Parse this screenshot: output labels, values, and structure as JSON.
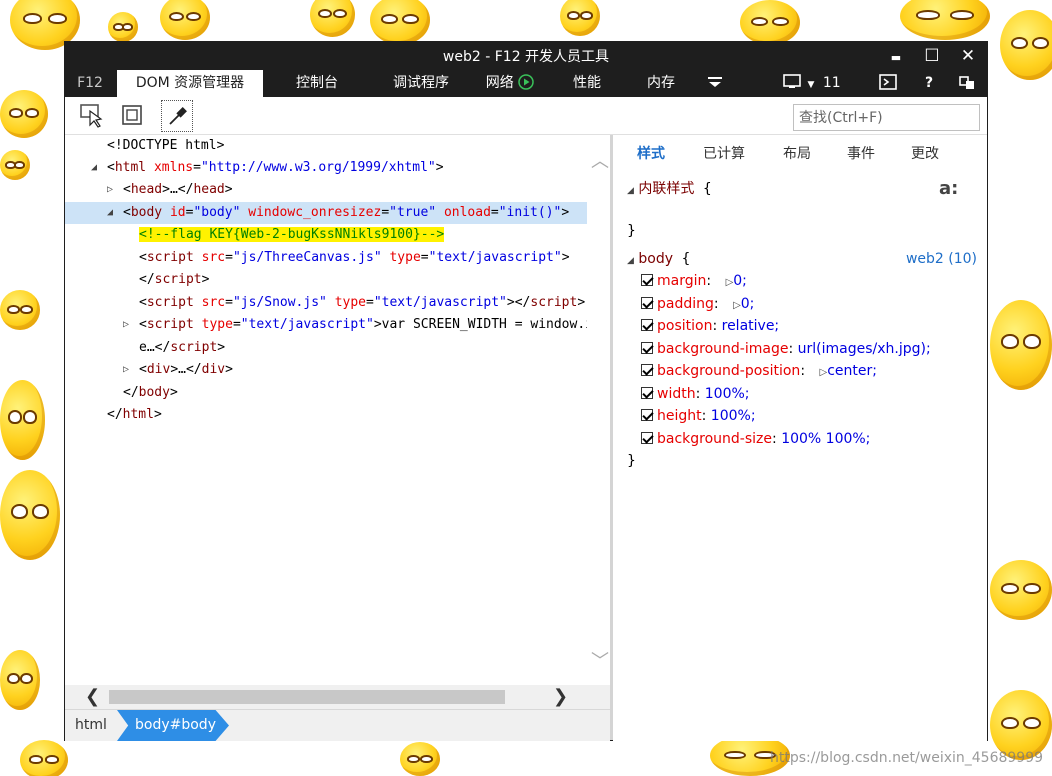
{
  "window": {
    "title": "web2 - F12 开发人员工具"
  },
  "window_controls": {
    "minimize": "▬",
    "maximize": "☐",
    "close": "✕"
  },
  "tabs": {
    "f12": "F12",
    "dom": "DOM 资源管理器",
    "console": "控制台",
    "debugger": "调试程序",
    "network": "网络",
    "performance": "性能",
    "memory": "内存",
    "emulation_count": "11",
    "help": "?"
  },
  "toolbar": {
    "search_placeholder": "查找(Ctrl+F)"
  },
  "dom_lines": [
    {
      "text": "<!DOCTYPE html>"
    },
    {
      "open": "<",
      "tag": "html",
      "attr1": "xmlns",
      "val1": "\"http://www.w3.org/1999/xhtml\"",
      "close": ">"
    },
    {
      "open": "<",
      "tag": "head",
      "rest": ">…</",
      "tag2": "head",
      "close": ">"
    },
    {
      "open": "<",
      "tag": "body",
      "attr1": "id",
      "val1": "\"body\"",
      "attr2": "windowc_onresizez",
      "val2": "\"true\"",
      "attr3": "onload",
      "val3": "\"init()\"",
      "close": ">"
    },
    {
      "comment": "<!--flag KEY{Web-2-bugKssNNikls9100}-->"
    },
    {
      "open": "<",
      "tag": "script",
      "attr1": "src",
      "val1": "\"js/ThreeCanvas.js\"",
      "attr2": "type",
      "val2": "\"text/javascript\"",
      "close": ">"
    },
    {
      "open": "</",
      "tag": "script",
      "close": ">"
    },
    {
      "open": "<",
      "tag": "script",
      "attr1": "src",
      "val1": "\"js/Snow.js\"",
      "attr2": "type",
      "val2": "\"text/javascript\"",
      "rest": "></",
      "tag2": "script",
      "close": ">"
    },
    {
      "open": "<",
      "tag": "script",
      "attr1": "type",
      "val1": "\"text/javascript\"",
      "rest": ">var SCREEN_WIDTH = window.innerWidth;"
    },
    {
      "rest": "e…</",
      "tag2": "script",
      "close": ">"
    },
    {
      "open": "<",
      "tag": "div",
      "rest": ">…</",
      "tag2": "div",
      "close": ">"
    },
    {
      "open": "</",
      "tag": "body",
      "close": ">"
    },
    {
      "open": "</",
      "tag": "html",
      "close": ">"
    }
  ],
  "breadcrumb": {
    "html": "html",
    "body": "body#body"
  },
  "styles_tabs": {
    "styles": "样式",
    "computed": "已计算",
    "layout": "布局",
    "events": "事件",
    "changes": "更改"
  },
  "styles": {
    "inline_header": "内联样式",
    "open_brace": "{",
    "close_brace": "}",
    "aa_icon": "a:",
    "body_selector": "body",
    "source": "web2 (10)",
    "props": [
      {
        "name": "margin",
        "value": "0;",
        "expand": true
      },
      {
        "name": "padding",
        "value": "0;",
        "expand": true
      },
      {
        "name": "position",
        "value": "relative;",
        "expand": false
      },
      {
        "name": "background-image",
        "value": "url(images/xh.jpg);",
        "expand": false
      },
      {
        "name": "background-position",
        "value": "center;",
        "expand": true
      },
      {
        "name": "width",
        "value": "100%;",
        "expand": false
      },
      {
        "name": "height",
        "value": "100%;",
        "expand": false
      },
      {
        "name": "background-size",
        "value": "100% 100%;",
        "expand": false
      }
    ]
  },
  "watermark": "https://blog.csdn.net/weixin_45689999"
}
